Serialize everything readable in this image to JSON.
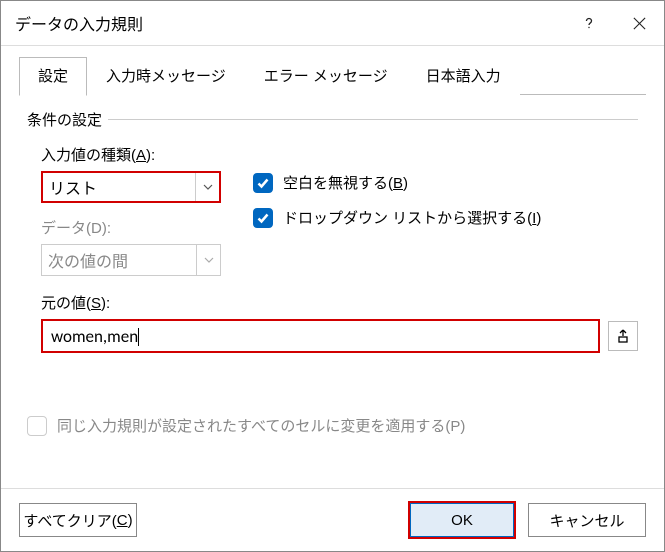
{
  "dialog": {
    "title": "データの入力規則"
  },
  "tabs": {
    "settings": "設定",
    "input_msg": "入力時メッセージ",
    "error_msg": "エラー メッセージ",
    "ime": "日本語入力"
  },
  "fieldset": {
    "title": "条件の設定"
  },
  "allow": {
    "label_pre": "入力値の種類(",
    "label_key": "A",
    "label_post": "):",
    "value": "リスト"
  },
  "data_field": {
    "label": "データ(D):",
    "value": "次の値の間"
  },
  "ignore_blank": {
    "label_pre": "空白を無視する(",
    "label_key": "B",
    "label_post": ")"
  },
  "dropdown": {
    "label_pre": "ドロップダウン リストから選択する(",
    "label_key": "I",
    "label_post": ")"
  },
  "source": {
    "label_pre": "元の値(",
    "label_key": "S",
    "label_post": "):",
    "value": "women,men"
  },
  "apply_all": {
    "label": "同じ入力規則が設定されたすべてのセルに変更を適用する(P)"
  },
  "footer": {
    "clear_pre": "すべてクリア(",
    "clear_key": "C",
    "clear_post": ")",
    "ok": "OK",
    "cancel": "キャンセル"
  }
}
